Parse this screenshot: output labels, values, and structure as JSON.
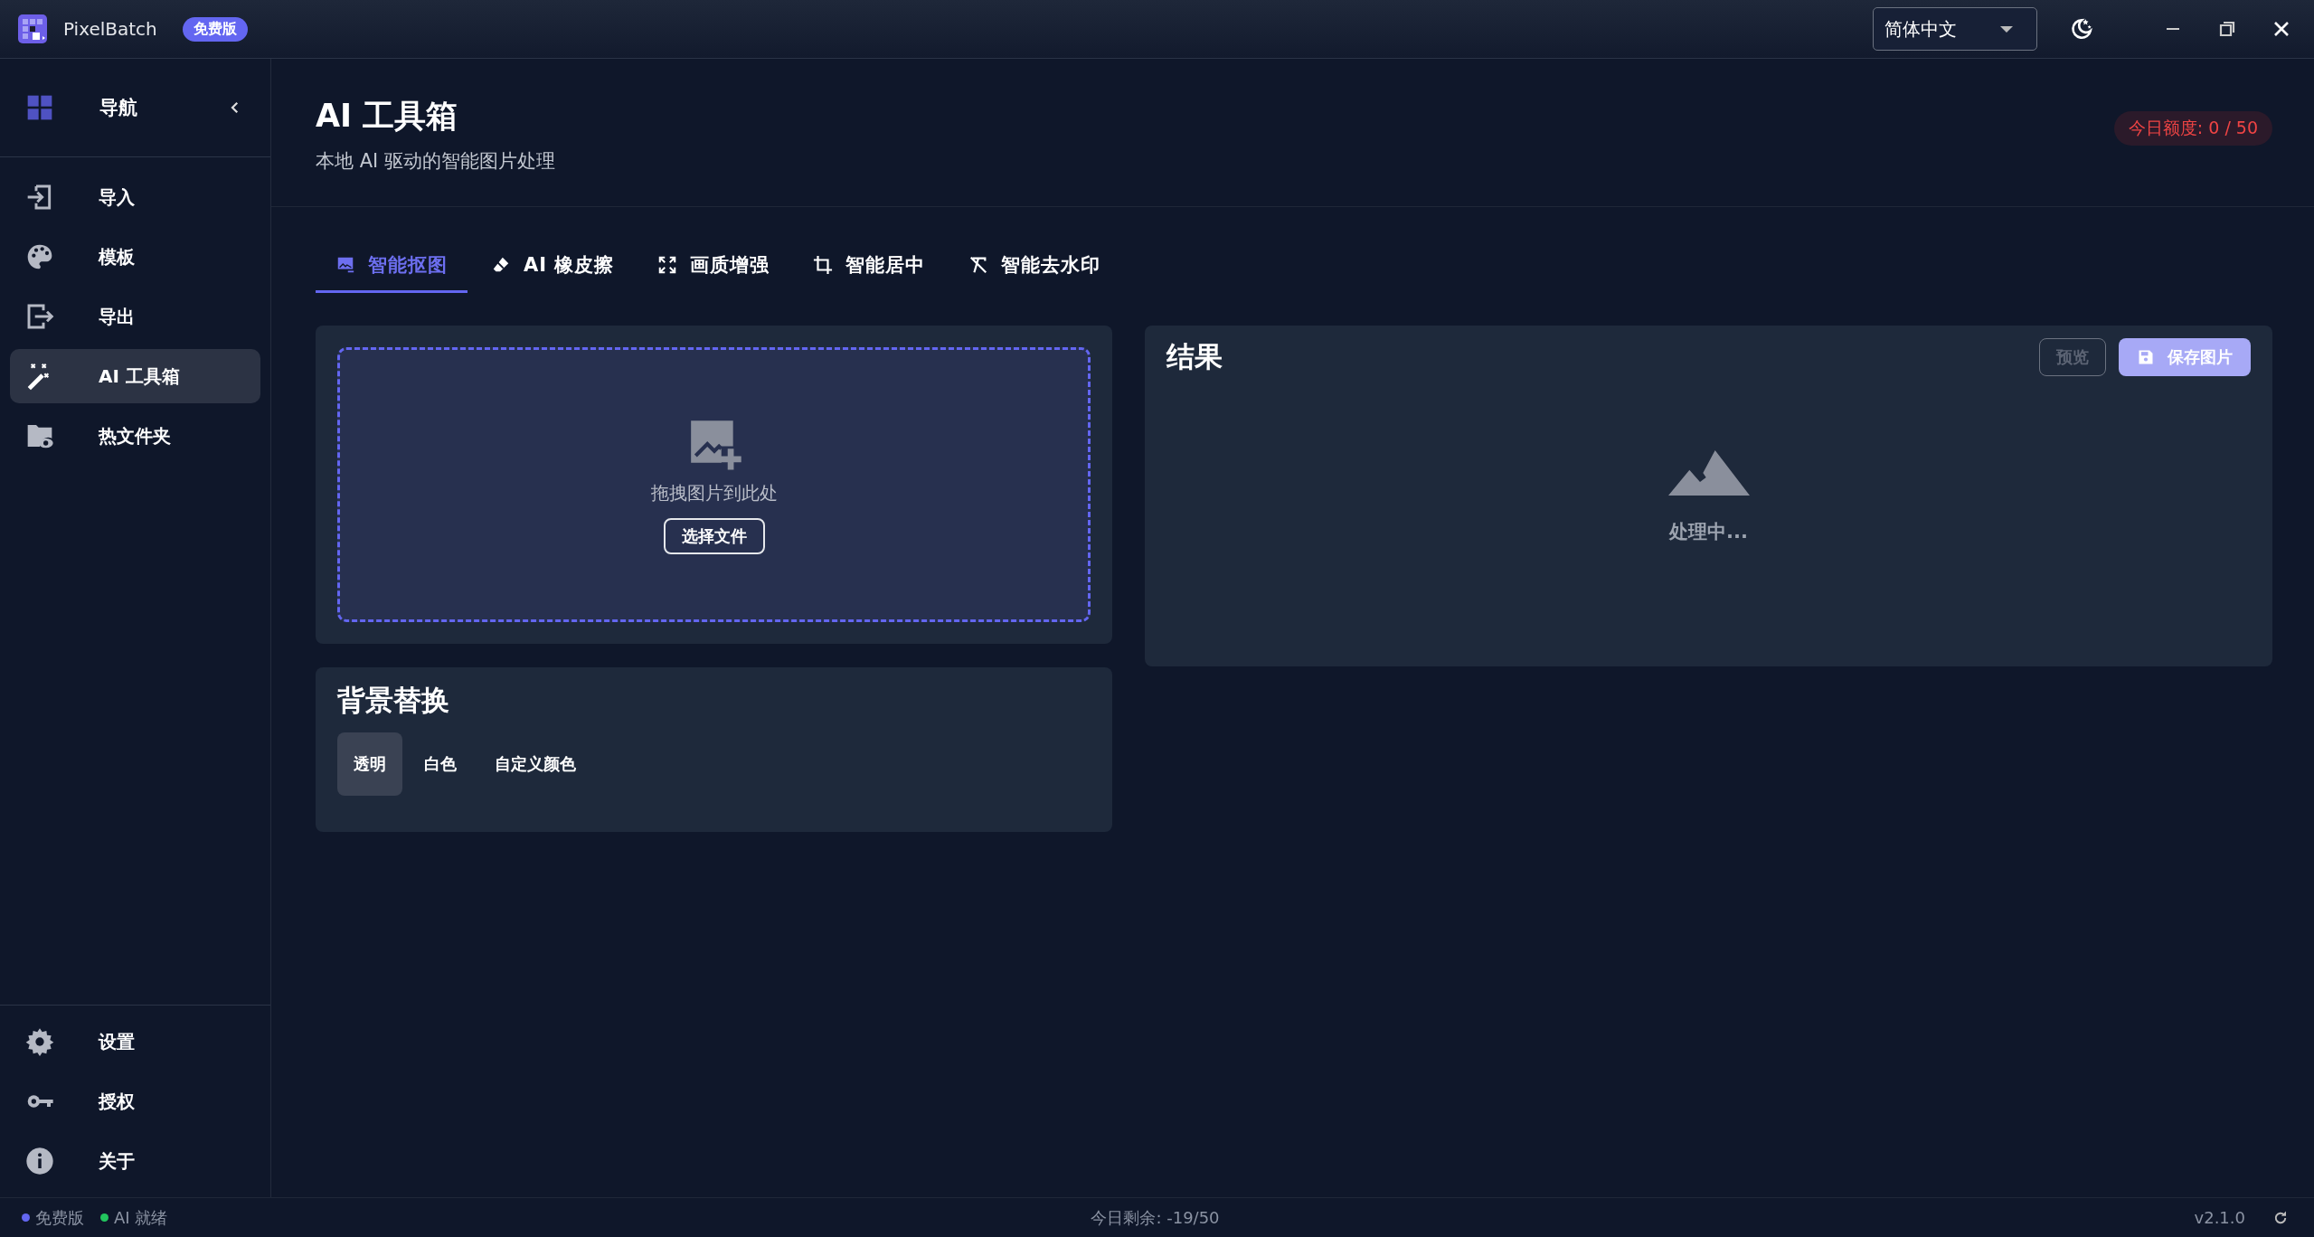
{
  "app": {
    "name": "PixelBatch",
    "badge": "免费版"
  },
  "language_select": {
    "value": "简体中文"
  },
  "sidebar": {
    "header": "导航",
    "items": [
      {
        "label": "导入",
        "selected": false
      },
      {
        "label": "模板",
        "selected": false
      },
      {
        "label": "导出",
        "selected": false
      },
      {
        "label": "AI 工具箱",
        "selected": true
      },
      {
        "label": "热文件夹",
        "selected": false
      }
    ],
    "bottom_items": [
      {
        "label": "设置"
      },
      {
        "label": "授权"
      },
      {
        "label": "关于"
      }
    ]
  },
  "page": {
    "title": "AI 工具箱",
    "subtitle": "本地 AI 驱动的智能图片处理",
    "quota_badge": "今日额度: 0 / 50"
  },
  "tabs": [
    {
      "label": "智能抠图",
      "selected": true
    },
    {
      "label": "AI 橡皮擦",
      "selected": false
    },
    {
      "label": "画质增强",
      "selected": false
    },
    {
      "label": "智能居中",
      "selected": false
    },
    {
      "label": "智能去水印",
      "selected": false
    }
  ],
  "upload": {
    "hint": "拖拽图片到此处",
    "button": "选择文件"
  },
  "background": {
    "title": "背景替换",
    "options": [
      {
        "label": "透明",
        "selected": true
      },
      {
        "label": "白色",
        "selected": false
      },
      {
        "label": "自定义颜色",
        "selected": false
      }
    ]
  },
  "result": {
    "title": "结果",
    "preview_button": {
      "label": "预览",
      "disabled": true
    },
    "save_button": "保存图片",
    "status": "处理中..."
  },
  "status_bar": {
    "items": [
      {
        "label": "免费版",
        "color": "#6366f1"
      },
      {
        "label": "AI 就绪",
        "color": "#22c55e"
      }
    ],
    "remaining": "今日剩余: -19/50",
    "version": "v2.1.0"
  }
}
